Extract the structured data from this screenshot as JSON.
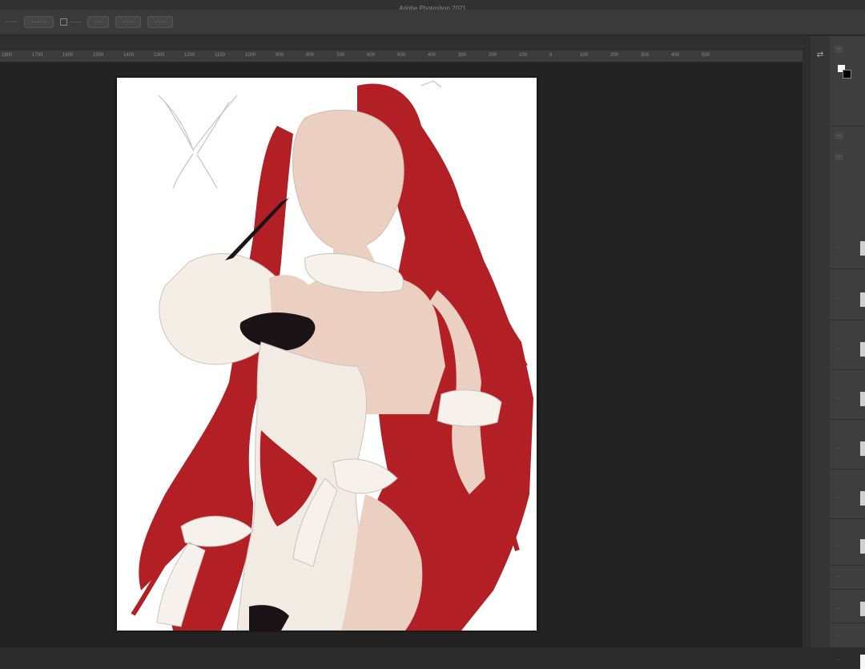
{
  "window": {
    "title": "Adobe Photoshop 2021"
  },
  "options_bar": {
    "items": [
      {
        "type": "text",
        "label": "·······"
      },
      {
        "type": "button",
        "label": "········"
      },
      {
        "type": "checkbox",
        "label": "······"
      },
      {
        "type": "button",
        "label": "····"
      },
      {
        "type": "button",
        "label": "······"
      },
      {
        "type": "button",
        "label": "······"
      }
    ]
  },
  "ruler": {
    "labels": [
      "1800",
      "1700",
      "1600",
      "1500",
      "1400",
      "1300",
      "1200",
      "1100",
      "1000",
      "900",
      "800",
      "700",
      "600",
      "500",
      "400",
      "300",
      "200",
      "100",
      "0",
      "100",
      "200",
      "300",
      "400",
      "500"
    ]
  },
  "panels": {
    "tabs": [
      "··",
      "··",
      "··"
    ],
    "foreground_color": "#ffffff",
    "background_color": "#000000"
  },
  "layers": [
    {
      "label": "··"
    },
    {
      "label": "··"
    },
    {
      "label": "··"
    },
    {
      "label": "··"
    },
    {
      "label": "··"
    },
    {
      "label": "··"
    },
    {
      "label": "··"
    },
    {
      "label": "··"
    },
    {
      "label": "··"
    },
    {
      "label": "··"
    },
    {
      "label": "··"
    }
  ],
  "colors": {
    "hair_red": "#b21f24",
    "skin": "#ebcfc0",
    "dress_cream": "#f1ebe3",
    "sketch_line": "#c9c2c0",
    "accent_black": "#1b1416"
  }
}
